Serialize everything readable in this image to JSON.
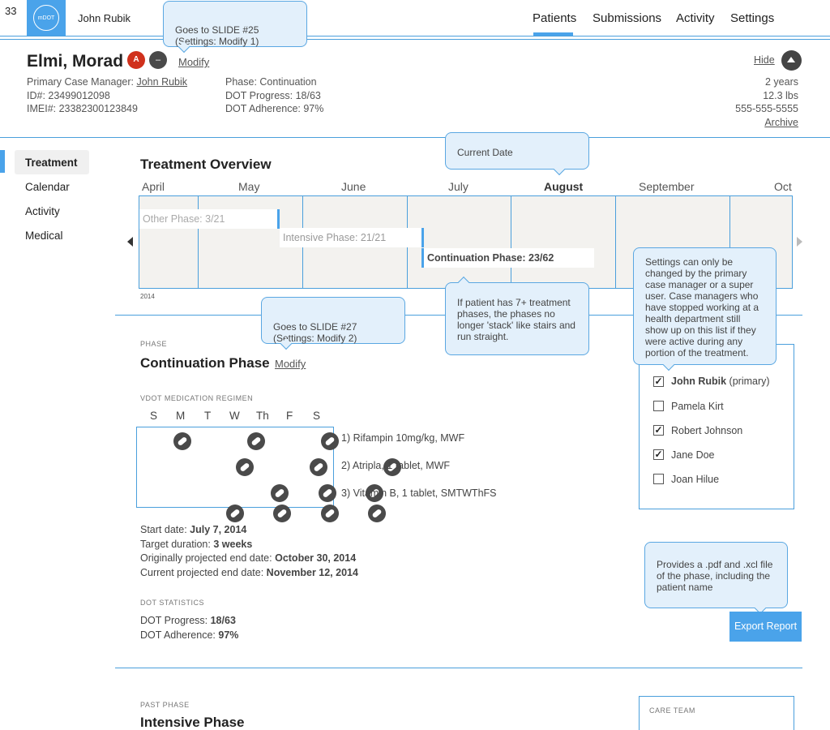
{
  "slide_number": "33",
  "brand": {
    "logo_text": "mDOT",
    "user_name": "John Rubik"
  },
  "nav": {
    "patients": "Patients",
    "submissions": "Submissions",
    "activity": "Activity",
    "settings": "Settings"
  },
  "patient": {
    "name": "Elmi, Morad",
    "badge_a": "A",
    "badge_dash": "–",
    "modify": "Modify",
    "case_manager_label": "Primary Case Manager:",
    "case_manager": "John Rubik",
    "id": "ID#: 23499012098",
    "imei": "IMEI#: 23382300123849",
    "phase": "Phase: Continuation",
    "dot_progress": "DOT Progress: 18/63",
    "dot_adherence": "DOT Adherence: 97%",
    "hide": "Hide",
    "age": "2 years",
    "weight": "12.3 lbs",
    "phone": "555-555-5555",
    "archive": "Archive"
  },
  "sidebar": {
    "items": [
      {
        "label": "Treatment"
      },
      {
        "label": "Calendar"
      },
      {
        "label": "Activity"
      },
      {
        "label": "Medical"
      }
    ]
  },
  "overview": {
    "title": "Treatment Overview",
    "months": [
      "April",
      "May",
      "June",
      "July",
      "August",
      "September",
      "Oct"
    ],
    "year": "2014",
    "phases": [
      "Other Phase: 3/21",
      "Intensive Phase: 21/21",
      "Continuation Phase: 23/62"
    ]
  },
  "phase": {
    "section_label": "PHASE",
    "title": "Continuation Phase",
    "modify": "Modify",
    "regimen_label": "VDOT MEDICATION REGIMEN",
    "days": [
      "S",
      "M",
      "T",
      "W",
      "Th",
      "F",
      "S"
    ],
    "meds": [
      "1)  Rifampin 10mg/kg, MWF",
      "2)  Atripla, 1 tablet, MWF",
      "3)  Vitamin B, 1 tablet, SMTWThFS"
    ],
    "start_label": "Start date:",
    "start_value": "July 7, 2014",
    "target_label": "Target duration:",
    "target_value": "3 weeks",
    "orig_label": "Originally projected end date:",
    "orig_value": "October 30, 2014",
    "curr_label": "Current projected end date:",
    "curr_value": "November 12, 2014",
    "stats_label": "DOT STATISTICS",
    "prog_label": "DOT Progress:",
    "prog_value": "18/63",
    "adh_label": "DOT Adherence:",
    "adh_value": "97%"
  },
  "care_team": {
    "members": [
      {
        "name": "John Rubik",
        "suffix": " (primary)",
        "checked": "✓"
      },
      {
        "name": "Pamela Kirt",
        "suffix": "",
        "checked": ""
      },
      {
        "name": "Robert Johnson",
        "suffix": "",
        "checked": "✓"
      },
      {
        "name": "Jane Doe",
        "suffix": "",
        "checked": "✓"
      },
      {
        "name": "Joan Hilue",
        "suffix": "",
        "checked": ""
      }
    ],
    "label": "CARE TEAM"
  },
  "export_button": "Export Report",
  "past": {
    "label": "PAST PHASE",
    "title": "Intensive Phase"
  },
  "callouts": {
    "slide25": "Goes to SLIDE #25\n(Settings: Modify 1)",
    "current_date": "Current Date",
    "stack": "If patient has 7+ treatment phases, the phases no longer 'stack' like stairs and run straight.",
    "slide27": "Goes to SLIDE #27\n(Settings: Modify 2)",
    "settings_note": "Settings can only be changed by the primary case manager or a super user. Case managers who have stopped working at a health department still show up on this list if they were active during any portion of the treatment.",
    "export_note": "Provides a .pdf and .xcl file of the phase, including the patient name"
  },
  "colors": {
    "accent": "#4aa3ea",
    "badge_red": "#d0311c",
    "badge_dark": "#4a4a4a"
  }
}
